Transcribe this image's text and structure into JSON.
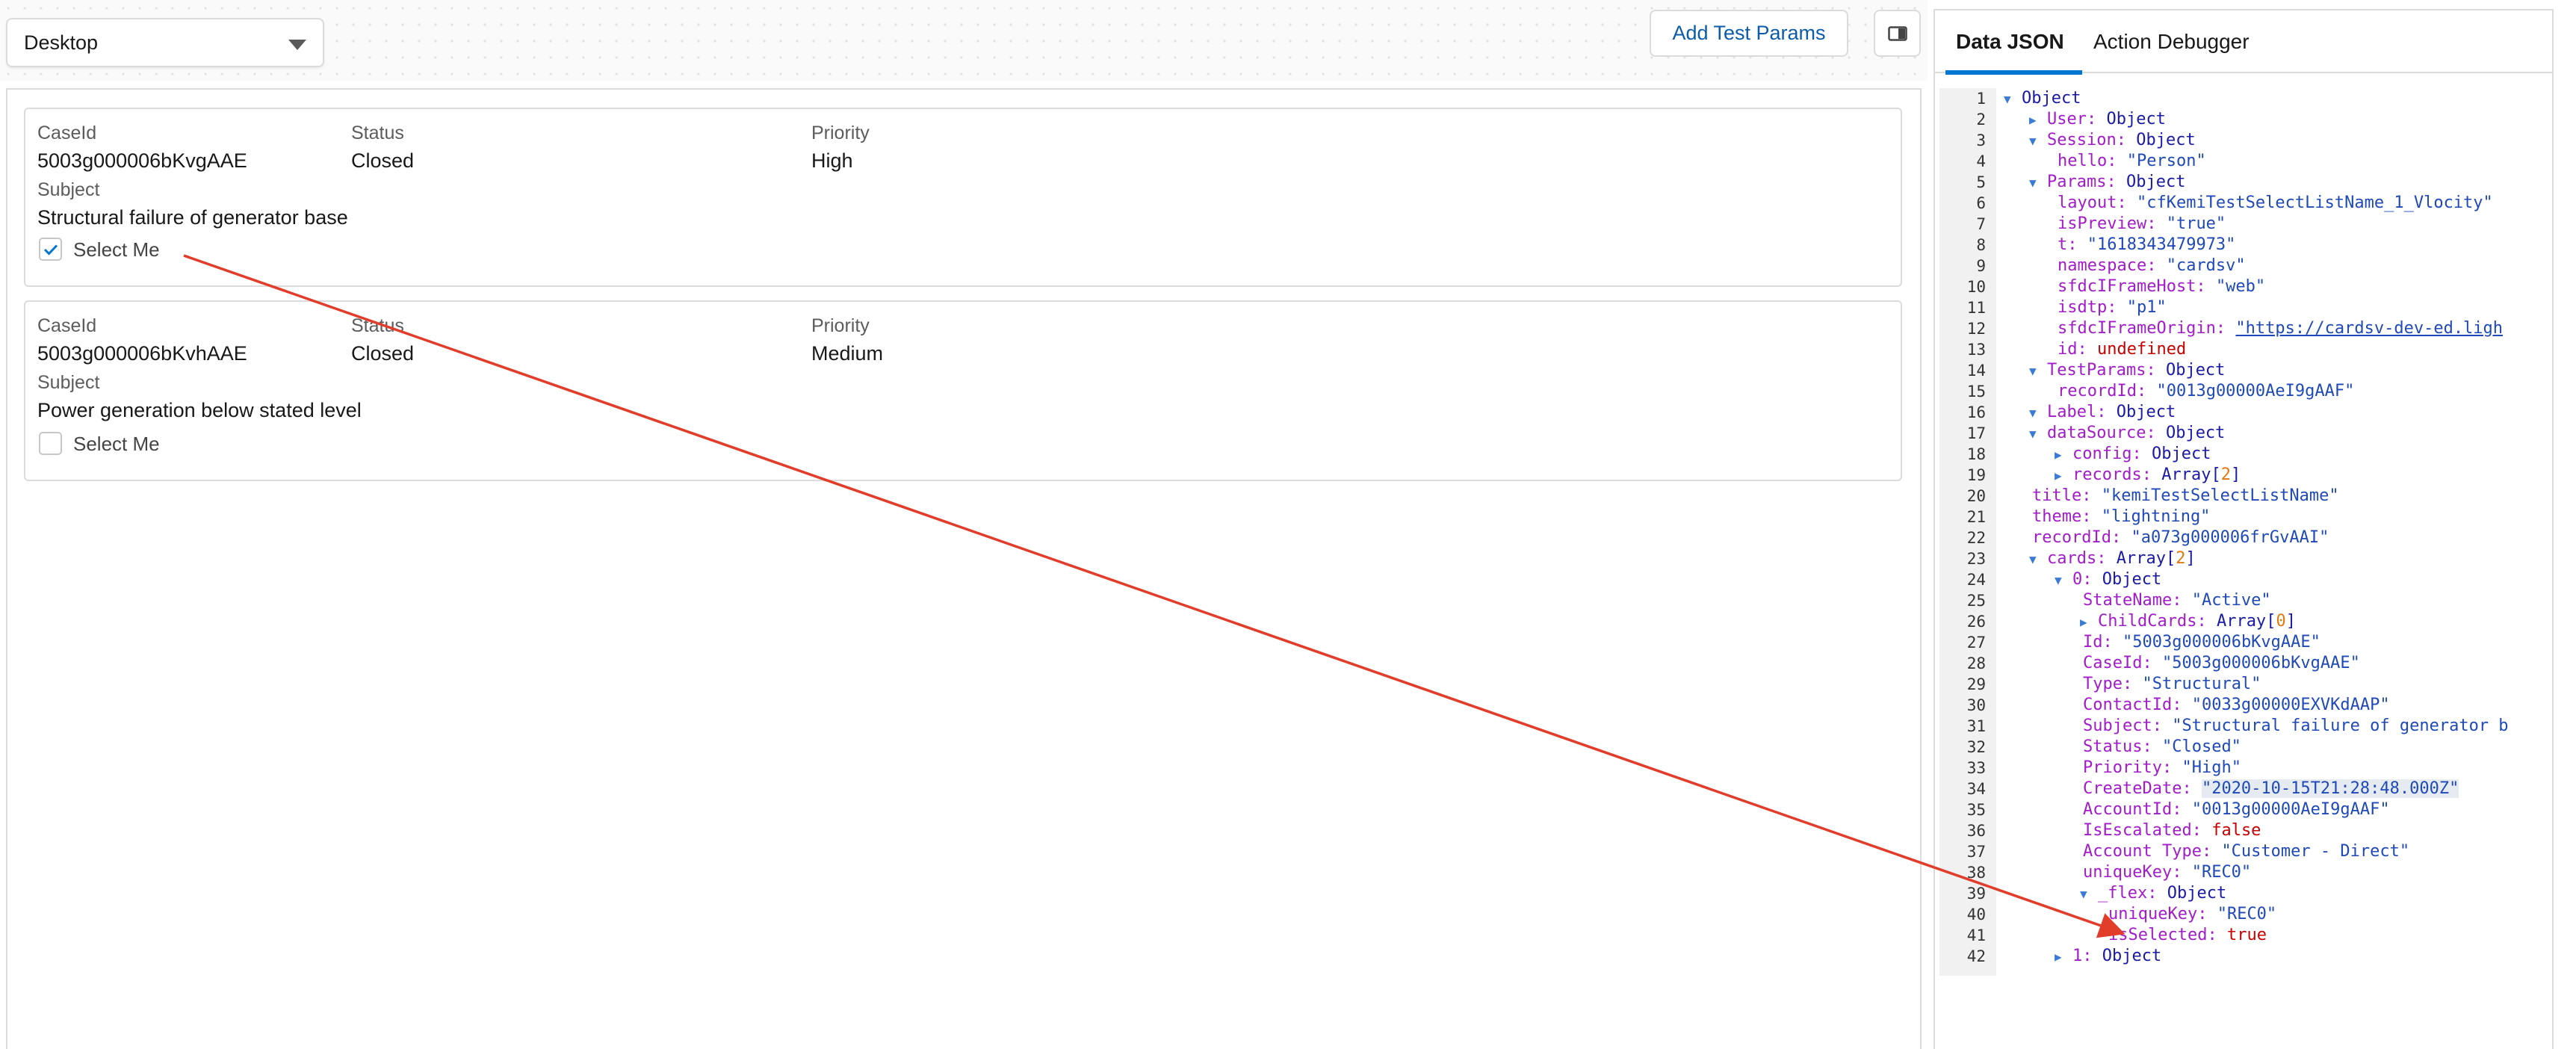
{
  "toolbar": {
    "device_select_value": "Desktop",
    "add_test_params_label": "Add Test Params"
  },
  "cards": [
    {
      "caseid_label": "CaseId",
      "caseid": "5003g000006bKvgAAE",
      "status_label": "Status",
      "status": "Closed",
      "priority_label": "Priority",
      "priority": "High",
      "subject_label": "Subject",
      "subject": "Structural failure of generator base",
      "select_label": "Select Me",
      "checked": true
    },
    {
      "caseid_label": "CaseId",
      "caseid": "5003g000006bKvhAAE",
      "status_label": "Status",
      "status": "Closed",
      "priority_label": "Priority",
      "priority": "Medium",
      "subject_label": "Subject",
      "subject": "Power generation below stated level",
      "select_label": "Select Me",
      "checked": false
    }
  ],
  "panel": {
    "tabs": [
      {
        "label": "Data JSON",
        "active": true
      },
      {
        "label": "Action Debugger",
        "active": false
      }
    ],
    "lines": [
      {
        "n": "1",
        "indent": 0,
        "tri": "down",
        "key": "",
        "val": "Object",
        "vtype": "o"
      },
      {
        "n": "2",
        "indent": 1,
        "tri": "right",
        "key": "User:",
        "val": "Object",
        "vtype": "o"
      },
      {
        "n": "3",
        "indent": 1,
        "tri": "down",
        "key": "Session:",
        "val": "Object",
        "vtype": "o"
      },
      {
        "n": "4",
        "indent": 2,
        "tri": "",
        "key": "hello:",
        "val": "\"Person\"",
        "vtype": "s"
      },
      {
        "n": "5",
        "indent": 1,
        "tri": "down",
        "key": "Params:",
        "val": "Object",
        "vtype": "o"
      },
      {
        "n": "6",
        "indent": 2,
        "tri": "",
        "key": "layout:",
        "val": "\"cfKemiTestSelectListName_1_Vlocity\"",
        "vtype": "s"
      },
      {
        "n": "7",
        "indent": 2,
        "tri": "",
        "key": "isPreview:",
        "val": "\"true\"",
        "vtype": "s"
      },
      {
        "n": "8",
        "indent": 2,
        "tri": "",
        "key": "t:",
        "val": "\"1618343479973\"",
        "vtype": "s"
      },
      {
        "n": "9",
        "indent": 2,
        "tri": "",
        "key": "namespace:",
        "val": "\"cardsv\"",
        "vtype": "s"
      },
      {
        "n": "10",
        "indent": 2,
        "tri": "",
        "key": "sfdcIFrameHost:",
        "val": "\"web\"",
        "vtype": "s"
      },
      {
        "n": "11",
        "indent": 2,
        "tri": "",
        "key": "isdtp:",
        "val": "\"p1\"",
        "vtype": "s"
      },
      {
        "n": "12",
        "indent": 2,
        "tri": "",
        "key": "sfdcIFrameOrigin:",
        "val": "\"https://cardsv-dev-ed.ligh",
        "vtype": "link"
      },
      {
        "n": "13",
        "indent": 2,
        "tri": "",
        "key": "id:",
        "val": "undefined",
        "vtype": "kw"
      },
      {
        "n": "14",
        "indent": 1,
        "tri": "down",
        "key": "TestParams:",
        "val": "Object",
        "vtype": "o"
      },
      {
        "n": "15",
        "indent": 2,
        "tri": "",
        "key": "recordId:",
        "val": "\"0013g00000AeI9gAAF\"",
        "vtype": "s"
      },
      {
        "n": "16",
        "indent": 1,
        "tri": "down",
        "key": "Label:",
        "val": "Object",
        "vtype": "o"
      },
      {
        "n": "17",
        "indent": 1,
        "tri": "down",
        "key": "dataSource:",
        "val": "Object",
        "vtype": "o"
      },
      {
        "n": "18",
        "indent": 2,
        "tri": "right",
        "key": "config:",
        "val": "Object",
        "vtype": "o"
      },
      {
        "n": "19",
        "indent": 2,
        "tri": "right",
        "key": "records:",
        "val": "Array",
        "vtype": "o",
        "count": "2"
      },
      {
        "n": "20",
        "indent": 1,
        "tri": "",
        "key": "title:",
        "val": "\"kemiTestSelectListName\"",
        "vtype": "s"
      },
      {
        "n": "21",
        "indent": 1,
        "tri": "",
        "key": "theme:",
        "val": "\"lightning\"",
        "vtype": "s"
      },
      {
        "n": "22",
        "indent": 1,
        "tri": "",
        "key": "recordId:",
        "val": "\"a073g000006frGvAAI\"",
        "vtype": "s"
      },
      {
        "n": "23",
        "indent": 1,
        "tri": "down",
        "key": "cards:",
        "val": "Array",
        "vtype": "o",
        "count": "2"
      },
      {
        "n": "24",
        "indent": 2,
        "tri": "down",
        "key": "0:",
        "val": "Object",
        "vtype": "o"
      },
      {
        "n": "25",
        "indent": 3,
        "tri": "",
        "key": "StateName:",
        "val": "\"Active\"",
        "vtype": "s"
      },
      {
        "n": "26",
        "indent": 3,
        "tri": "right",
        "key": "ChildCards:",
        "val": "Array",
        "vtype": "o",
        "count": "0"
      },
      {
        "n": "27",
        "indent": 3,
        "tri": "",
        "key": "Id:",
        "val": "\"5003g000006bKvgAAE\"",
        "vtype": "s"
      },
      {
        "n": "28",
        "indent": 3,
        "tri": "",
        "key": "CaseId:",
        "val": "\"5003g000006bKvgAAE\"",
        "vtype": "s"
      },
      {
        "n": "29",
        "indent": 3,
        "tri": "",
        "key": "Type:",
        "val": "\"Structural\"",
        "vtype": "s"
      },
      {
        "n": "30",
        "indent": 3,
        "tri": "",
        "key": "ContactId:",
        "val": "\"0033g00000EXVKdAAP\"",
        "vtype": "s"
      },
      {
        "n": "31",
        "indent": 3,
        "tri": "",
        "key": "Subject:",
        "val": "\"Structural failure of generator b",
        "vtype": "s"
      },
      {
        "n": "32",
        "indent": 3,
        "tri": "",
        "key": "Status:",
        "val": "\"Closed\"",
        "vtype": "s"
      },
      {
        "n": "33",
        "indent": 3,
        "tri": "",
        "key": "Priority:",
        "val": "\"High\"",
        "vtype": "s"
      },
      {
        "n": "34",
        "indent": 3,
        "tri": "",
        "key": "CreateDate:",
        "val": "\"2020-10-15T21:28:48.000Z\"",
        "vtype": "s",
        "hl": true
      },
      {
        "n": "35",
        "indent": 3,
        "tri": "",
        "key": "AccountId:",
        "val": "\"0013g00000AeI9gAAF\"",
        "vtype": "s"
      },
      {
        "n": "36",
        "indent": 3,
        "tri": "",
        "key": "IsEscalated:",
        "val": "false",
        "vtype": "kw"
      },
      {
        "n": "37",
        "indent": 3,
        "tri": "",
        "key": "Account Type:",
        "val": "\"Customer - Direct\"",
        "vtype": "s"
      },
      {
        "n": "38",
        "indent": 3,
        "tri": "",
        "key": "uniqueKey:",
        "val": "\"REC0\"",
        "vtype": "s"
      },
      {
        "n": "39",
        "indent": 3,
        "tri": "down",
        "key": "_flex:",
        "val": "Object",
        "vtype": "o"
      },
      {
        "n": "40",
        "indent": 4,
        "tri": "",
        "key": "uniqueKey:",
        "val": "\"REC0\"",
        "vtype": "s"
      },
      {
        "n": "41",
        "indent": 4,
        "tri": "",
        "key": "isSelected:",
        "val": "true",
        "vtype": "kw"
      },
      {
        "n": "42",
        "indent": 2,
        "tri": "right",
        "key": "1:",
        "val": "Object",
        "vtype": "o"
      }
    ]
  },
  "colors": {
    "accent": "#0176d3",
    "arrow": "#e23c2a",
    "link_button": "#0b5cab"
  }
}
